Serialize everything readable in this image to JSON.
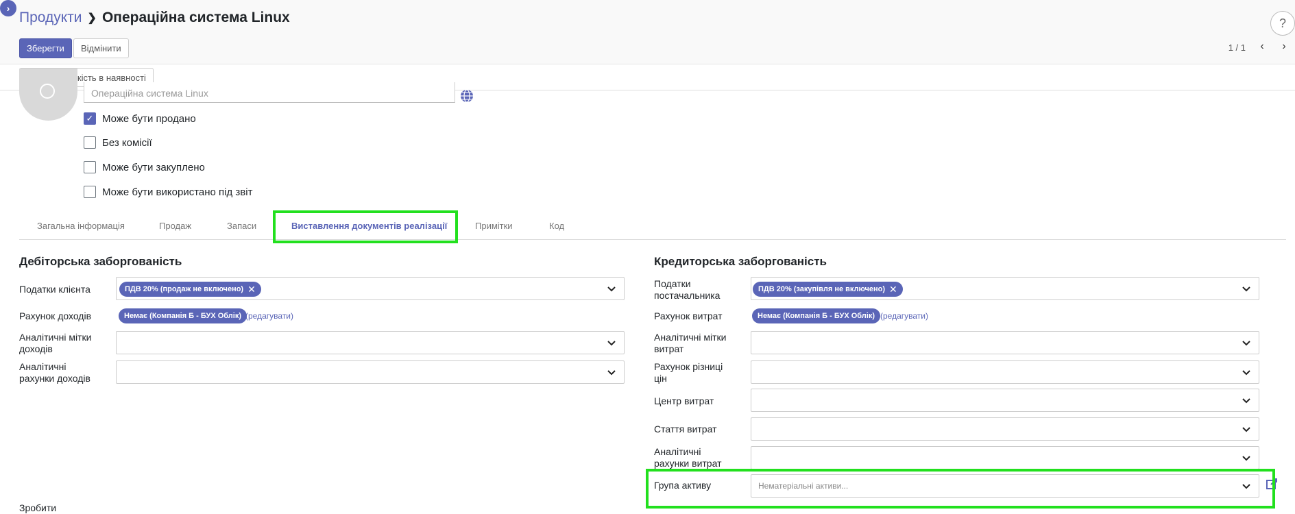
{
  "breadcrumb": {
    "parent": "Продукти",
    "current": "Операційна система Linux"
  },
  "toolbar": {
    "save_label": "Зберегти",
    "discard_label": "Відмінити",
    "pager": "1 / 1",
    "help": "?"
  },
  "statusbar": {
    "update_qty_label": "Змінити кількість в наявності"
  },
  "product": {
    "name_placeholder": "Операційна система Linux",
    "checkboxes": [
      {
        "label": "Може бути продано",
        "checked": true
      },
      {
        "label": "Без комісії",
        "checked": false
      },
      {
        "label": "Може бути закуплено",
        "checked": false
      },
      {
        "label": "Може бути використано під звіт",
        "checked": false
      }
    ]
  },
  "tabs": [
    "Загальна інформація",
    "Продаж",
    "Запаси",
    "Виставлення документів реалізації",
    "Примітки",
    "Код"
  ],
  "receivable": {
    "title": "Дебіторська заборгованість",
    "customer_taxes_label": "Податки клієнта",
    "customer_tax_tag": "ПДВ 20% (продаж не включено)",
    "income_account_label": "Рахунок доходів",
    "income_account_tag": "Немає (Компанія Б - БУХ Облік)",
    "edit_link": "(редагувати)",
    "income_tags_label": "Аналітичні мітки доходів",
    "income_analytic_label": "Аналітичні рахунки доходів"
  },
  "payable": {
    "title": "Кредиторська заборгованість",
    "vendor_taxes_label": "Податки постачальника",
    "vendor_tax_tag": "ПДВ 20% (закупівля не включено)",
    "expense_account_label": "Рахунок витрат",
    "expense_account_tag": "Немає (Компанія Б - БУХ Облік)",
    "edit_link": "(редагувати)",
    "expense_tags_label": "Аналітичні мітки витрат",
    "price_diff_label": "Рахунок різниці цін",
    "cost_center_label": "Центр витрат",
    "cost_item_label": "Стаття витрат",
    "expense_analytic_label": "Аналітичні рахунки витрат",
    "asset_group_label": "Група активу",
    "asset_group_placeholder": "Нематеріальні активи..."
  },
  "footer": {
    "make_label": "Зробити"
  },
  "colors": {
    "accent": "#5a65b7",
    "highlight": "#22e01e"
  }
}
